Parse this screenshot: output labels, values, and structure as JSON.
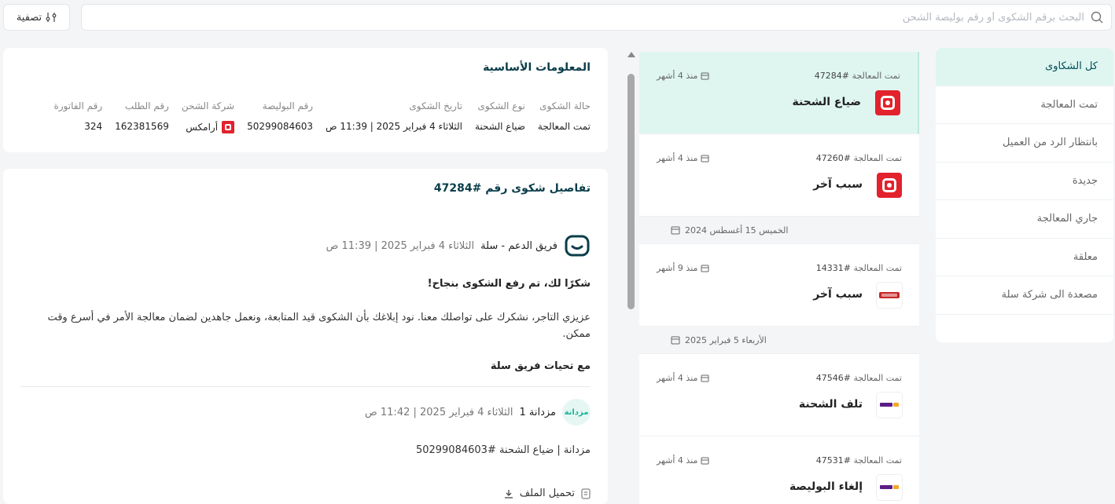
{
  "topbar": {
    "search_placeholder": "البحث برقم الشكوى أو رقم بوليصة الشحن",
    "filter_label": "تصفية"
  },
  "sidebar": {
    "items": [
      {
        "label": "كل الشكاوى",
        "active": true
      },
      {
        "label": "تمت المعالجة"
      },
      {
        "label": "بانتظار الرد من العميل"
      },
      {
        "label": "جديدة"
      },
      {
        "label": "جاري المعالجة"
      },
      {
        "label": "معلقة"
      },
      {
        "label": "مصعدة الى شركة سلة"
      }
    ]
  },
  "complaints": [
    {
      "status": "تمت المعالجة",
      "id": "#47284",
      "ago": "منذ 4 أشهر",
      "title": "ضياع الشحنة",
      "carrier": "aramex"
    },
    {
      "status": "تمت المعالجة",
      "id": "#47260",
      "ago": "منذ 4 أشهر",
      "title": "سبب آخر",
      "carrier": "aramex"
    },
    {
      "date_sep": "الخميس 15 أغسطس 2024"
    },
    {
      "status": "تمت المعالجة",
      "id": "#14331",
      "ago": "منذ 9 أشهر",
      "title": "سبب آخر",
      "carrier": "red"
    },
    {
      "date_sep": "الأربعاء 5 فبراير 2025"
    },
    {
      "status": "تمت المعالجة",
      "id": "#47546",
      "ago": "منذ 4 أشهر",
      "title": "تلف الشحنة",
      "carrier": "smsa"
    },
    {
      "status": "تمت المعالجة",
      "id": "#47531",
      "ago": "منذ 4 أشهر",
      "title": "إلغاء البوليصة",
      "carrier": "smsa"
    }
  ],
  "basic_info": {
    "title": "المعلومات الأساسية",
    "fields": [
      {
        "label": "حالة الشكوى",
        "value": "تمت المعالجة"
      },
      {
        "label": "نوع الشكوى",
        "value": "ضياع الشحنة"
      },
      {
        "label": "تاريخ الشكوى",
        "value": "الثلاثاء 4 فبراير 2025 | 11:39 ص"
      },
      {
        "label": "رقم البوليصة",
        "value": "50299084603"
      },
      {
        "label": "شركة الشحن",
        "value": "أرامكس"
      },
      {
        "label": "رقم الطلب",
        "value": "162381569"
      },
      {
        "label": "رقم الفاتورة",
        "value": "324"
      }
    ]
  },
  "details": {
    "title": "تفاصيل شكوى رقم #47284",
    "msg1": {
      "sender": "فريق الدعم - سلة",
      "time": "الثلاثاء 4 فبراير 2025 | 11:39 ص",
      "heading": "شكرًا لك، تم رفع الشكوى بنجاح!",
      "body_line1": "عزيزي التاجر، نشكرك على تواصلك معنا. نود إبلاغك بأن الشكوى قيد المتابعة، ونعمل جاهدين لضمان معالجة الأمر في أسرع وقت",
      "body_line2": "ممكن.",
      "signoff": "مع تحيات فريق سلة"
    },
    "msg2": {
      "avatar_text": "مزدانة",
      "sender": "مزدانة 1",
      "time": "الثلاثاء 4 فبراير 2025 | 11:42 ص",
      "body": "مزدانة | ضياع الشحنة #50299084603",
      "attachment_label": "تحميل الملف"
    }
  },
  "colors": {
    "accent": "#004d5a",
    "active_bg": "#dff6f0",
    "aramex": "#e2222c"
  }
}
